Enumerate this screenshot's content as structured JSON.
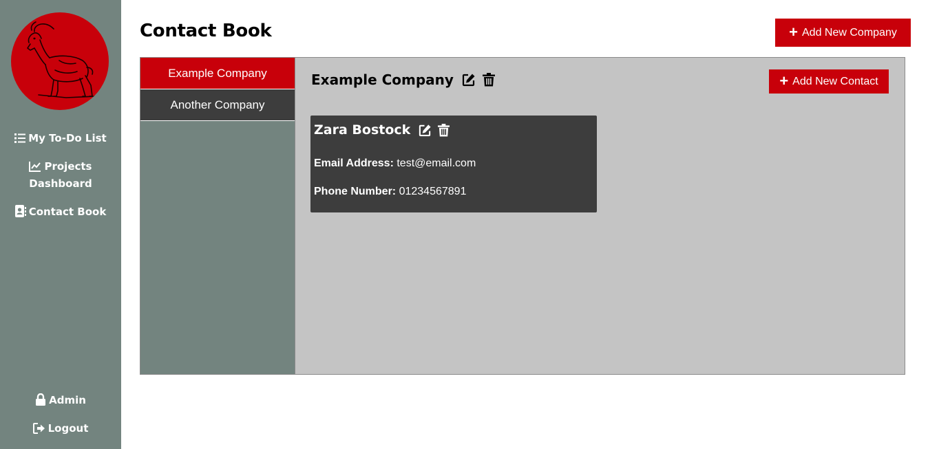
{
  "sidebar": {
    "nav": [
      {
        "label": "My To-Do List",
        "icon": "list-icon"
      },
      {
        "label": "Projects Dashboard",
        "icon": "chart-line-icon"
      },
      {
        "label": "Contact Book",
        "icon": "address-book-icon"
      }
    ],
    "bottom": [
      {
        "label": "Admin",
        "icon": "lock-icon"
      },
      {
        "label": "Logout",
        "icon": "sign-out-icon"
      }
    ]
  },
  "header": {
    "title": "Contact Book",
    "add_company_label": "Add New Company"
  },
  "companies": [
    {
      "name": "Example Company",
      "selected": true
    },
    {
      "name": "Another Company",
      "selected": false
    }
  ],
  "selected_company": {
    "name": "Example Company",
    "add_contact_label": "Add New Contact",
    "contacts": [
      {
        "name": "Zara Bostock",
        "email_label": "Email Address:",
        "email": "test@email.com",
        "phone_label": "Phone Number:",
        "phone": "01234567891"
      }
    ]
  },
  "colors": {
    "accent": "#c8000a",
    "sidebar": "#73847f",
    "panel": "#c4c4c4",
    "card": "#3d3d3d"
  }
}
